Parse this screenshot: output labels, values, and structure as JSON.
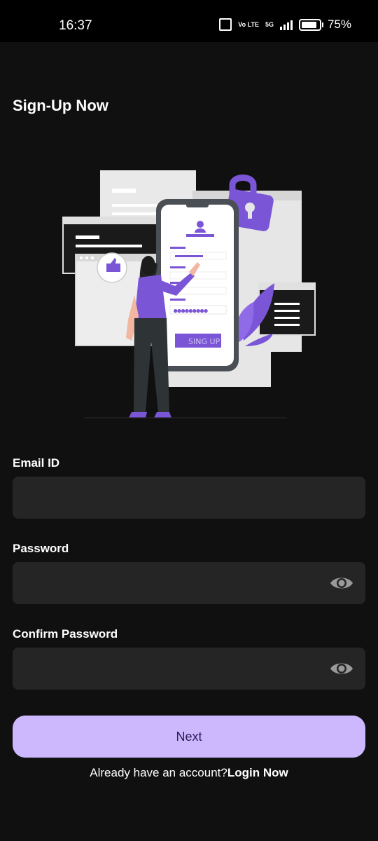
{
  "status_bar": {
    "time": "16:37",
    "volte": "Vo LTE",
    "network": "5G",
    "battery": "75%"
  },
  "header": {
    "title": "Sign-Up Now"
  },
  "illustration": {
    "button_text": "SING UP",
    "accent_color": "#7a55d6"
  },
  "form": {
    "email": {
      "label": "Email ID",
      "value": "",
      "placeholder": ""
    },
    "password": {
      "label": "Password",
      "value": "",
      "placeholder": "",
      "toggle_icon": "eye-icon"
    },
    "confirm_password": {
      "label": "Confirm Password",
      "value": "",
      "placeholder": "",
      "toggle_icon": "eye-icon"
    }
  },
  "actions": {
    "next_label": "Next",
    "login_prompt": "Already have an account?",
    "login_link": "Login Now"
  },
  "colors": {
    "background": "#101010",
    "field": "#252525",
    "button": "#cdb8fd",
    "button_text": "#2b1c56"
  }
}
